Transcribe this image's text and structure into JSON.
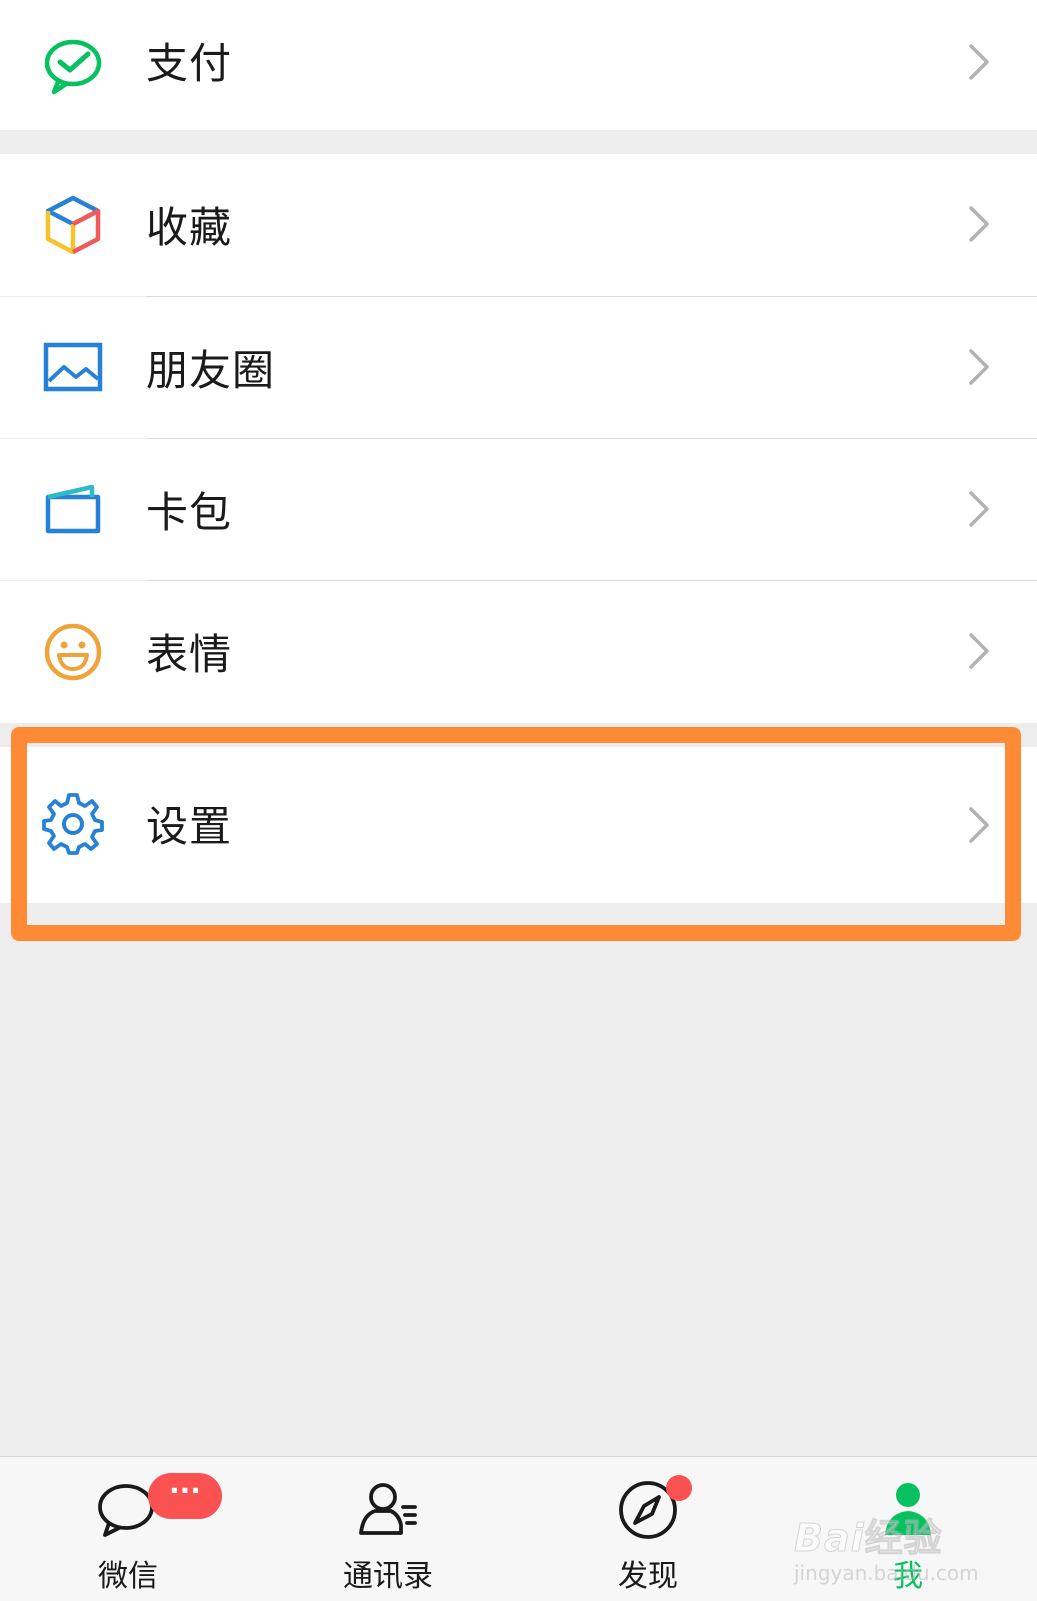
{
  "menu": [
    {
      "key": "pay",
      "label": "支付",
      "icon": "wechat-pay-icon"
    },
    {
      "key": "favorites",
      "label": "收藏",
      "icon": "favorites-cube-icon"
    },
    {
      "key": "moments",
      "label": "朋友圈",
      "icon": "photo-album-icon"
    },
    {
      "key": "cards",
      "label": "卡包",
      "icon": "card-wallet-icon"
    },
    {
      "key": "stickers",
      "label": "表情",
      "icon": "smiley-face-icon"
    },
    {
      "key": "settings",
      "label": "设置",
      "icon": "gear-icon"
    }
  ],
  "tabbar": {
    "tabs": [
      {
        "key": "chats",
        "label": "微信",
        "icon": "chat-bubble-icon"
      },
      {
        "key": "contacts",
        "label": "通讯录",
        "icon": "contacts-icon"
      },
      {
        "key": "discover",
        "label": "发现",
        "icon": "compass-icon"
      },
      {
        "key": "me",
        "label": "我",
        "icon": "person-icon",
        "active": true
      }
    ],
    "chats_badge": "···"
  },
  "watermark": {
    "brand": "Bai",
    "brand_cn": "经验",
    "url": "jingyan.baidu.com"
  },
  "colors": {
    "accent_green": "#07c160",
    "badge_red": "#fa5151",
    "highlight_orange": "#ff8a35",
    "icon_blue": "#2782d7",
    "icon_orange": "#f0a33b"
  }
}
